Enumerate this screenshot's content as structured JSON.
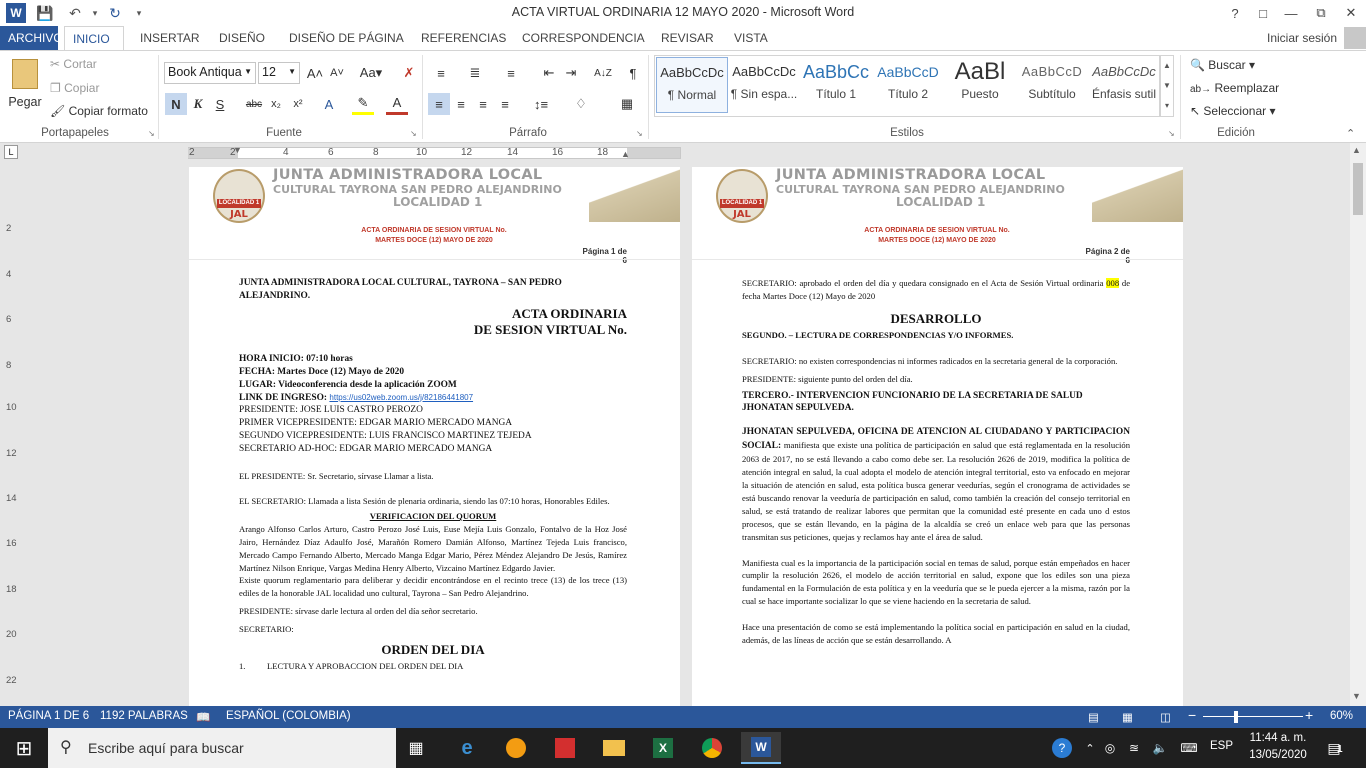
{
  "window": {
    "title": "ACTA VIRTUAL ORDINARIA 12 MAYO 2020 - Microsoft Word",
    "help": "?",
    "signin": "Iniciar sesión"
  },
  "tabs": [
    "ARCHIVO",
    "INICIO",
    "INSERTAR",
    "DISEÑO",
    "DISEÑO DE PÁGINA",
    "REFERENCIAS",
    "CORRESPONDENCIA",
    "REVISAR",
    "VISTA"
  ],
  "ribbon": {
    "clipboard": {
      "paste": "Pegar",
      "cut": "Cortar",
      "copy": "Copiar",
      "format_painter": "Copiar formato",
      "label": "Portapapeles"
    },
    "font": {
      "family": "Book Antiqua",
      "size": "12",
      "label": "Fuente"
    },
    "paragraph": {
      "label": "Párrafo"
    },
    "styles": {
      "label": "Estilos",
      "items": [
        {
          "preview": "AaBbCcDc",
          "name": "¶ Normal"
        },
        {
          "preview": "AaBbCcDc",
          "name": "¶ Sin espa..."
        },
        {
          "preview": "AaBbCc",
          "name": "Título 1"
        },
        {
          "preview": "AaBbCcD",
          "name": "Título 2"
        },
        {
          "preview": "AaBl",
          "name": "Puesto"
        },
        {
          "preview": "AaBbCcD",
          "name": "Subtítulo"
        },
        {
          "preview": "AaBbCcDc",
          "name": "Énfasis sutil"
        }
      ]
    },
    "editing": {
      "find": "Buscar",
      "replace": "Reemplazar",
      "select": "Seleccionar",
      "label": "Edición"
    }
  },
  "ruler": [
    "2",
    "2",
    "4",
    "6",
    "8",
    "10",
    "12",
    "14",
    "16",
    "18"
  ],
  "vruler": [
    "2",
    "4",
    "6",
    "8",
    "10",
    "12",
    "14",
    "16",
    "18",
    "20",
    "22"
  ],
  "header": {
    "line1": "JUNTA ADMINISTRADORA LOCAL",
    "line2": "CULTURAL TAYRONA SAN PEDRO ALEJANDRINO",
    "line3": "LOCALIDAD 1",
    "logo_text": "LOCALIDAD 1",
    "logo_jal": "JAL",
    "acta1": "ACTA ORDINARIA DE SESION VIRTUAL No.",
    "acta2": "MARTES DOCE (12) MAYO DE 2020"
  },
  "page1": {
    "pgnum": "Página 1 de 6",
    "org": "JUNTA ADMINISTRADORA LOCAL CULTURAL, TAYRONA – SAN PEDRO ALEJANDRINO.",
    "title1": "ACTA ORDINARIA",
    "title2": "DE SESION VIRTUAL No.",
    "hora": "HORA INICIO: 07:10 horas",
    "fecha": "FECHA: Martes Doce (12) Mayo de 2020",
    "lugar": "LUGAR: Videoconferencia desde la aplicación ZOOM",
    "link_label": "LINK DE INGRESO:",
    "link": "https://us02web.zoom.us/j/82186441807",
    "presidente": "PRESIDENTE: JOSE LUIS CASTRO PEROZO",
    "primer": "PRIMER VICEPRESIDENTE: EDGAR MARIO MERCADO MANGA",
    "segundo": "SEGUNDO VICEPRESIDENTE: LUIS FRANCISCO MARTINEZ TEJEDA",
    "secretario": "SECRETARIO AD-HOC: EDGAR MARIO MERCADO MANGA",
    "p_pres": "EL PRESIDENTE: Sr. Secretario, sírvase Llamar a lista.",
    "p_sec": "EL SECRETARIO: Llamada a lista Sesión de plenaria ordinaria, siendo las 07:10 horas, Honorables Ediles.",
    "quorum_title": "VERIFICACION DEL QUORUM",
    "quorum_text": "Arango Alfonso Carlos Arturo, Castro Perozo José Luis, Euse Mejía Luis Gonzalo, Fontalvo de la Hoz José Jairo, Hernández Díaz Adaulfo José, Marañón Romero Damián Alfonso, Martínez Tejeda Luis francisco, Mercado Campo Fernando Alberto, Mercado Manga Edgar Mario,  Pérez Méndez Alejandro De Jesús, Ramírez Martínez Nilson Enrique, Vargas Medina Henry Alberto, Vizcaino Martínez Edgardo Javier.",
    "quorum_text2": "Existe quorum reglamentario para deliberar y decidir encontrándose en el recinto trece (13) de los trece (13) ediles de la  honorable JAL localidad uno cultural, Tayrona – San Pedro Alejandrino.",
    "p_pres2": "PRESIDENTE: sírvase darle lectura al orden del día señor secretario.",
    "p_sec2": "SECRETARIO:",
    "orden": "ORDEN DEL DIA",
    "item1_num": "1.",
    "item1": "LECTURA Y APROBACCION DEL ORDEN DEL DIA"
  },
  "page2": {
    "pgnum": "Página 2 de 6",
    "sec1a": "SECRETARIO: aprobado el orden del día y quedara consignado en el Acta de Sesión Virtual ordinaria",
    "sec1_hl": "008",
    "sec1b": "de fecha Martes Doce (12) Mayo de 2020",
    "desarrollo": "DESARROLLO",
    "segundo": "SEGUNDO. – LECTURA DE CORRESPONDENCIAS Y/O INFORMES.",
    "sec2": "SECRETARIO: no existen correspondencias ni informes radicados en la secretaria general de la corporación.",
    "pres": "PRESIDENTE: siguiente punto del orden del día.",
    "tercero": "TERCERO.-  INTERVENCION FUNCIONARIO DE LA SECRETARIA DE SALUD JHONATAN SEPULVEDA.",
    "jhon_bold": "JHONATAN SEPULVEDA, OFICINA DE ATENCION AL CIUDADANO Y PARTICIPACION SOCIAL:",
    "jhon_text": " manifiesta que existe una política de participación en salud que está reglamentada en la resolución 2063 de 2017, no se está llevando a cabo como debe ser. La resolución 2626 de 2019, modifica la política de atención integral en salud, la cual adopta el modelo de atención integral territorial, esto va enfocado en mejorar la situación de atención en salud, esta política busca generar veedurías, según el cronograma de actividades se está buscando renovar la veeduría de participación en salud, como también la creación del consejo territorial en salud, se está tratando de realizar labores que permitan que la comunidad esté presente en cada uno d estos procesos, que se están llevando, en la página de la alcaldía se creó un enlace web para que las personas transmitan sus peticiones, quejas y reclamos hay ante el área de salud.",
    "para2": "Manifiesta cual es la importancia de la participación social en temas de salud, porque están empeñados en hacer cumplir la resolución 2626, el modelo de acción territorial en salud, expone que los ediles son una pieza fundamental en la Formulación de esta política y en la veeduría que se le pueda ejercer a la misma, razón por la cual se hace importante socializar lo que se viene haciendo en la secretaria de salud.",
    "para3": "Hace una presentación de como se está implementando la política social en participación en salud en la ciudad, además, de las líneas de acción que se están desarrollando. A"
  },
  "status": {
    "page": "PÁGINA 1 DE 6",
    "words": "1192 PALABRAS",
    "lang": "ESPAÑOL (COLOMBIA)",
    "zoom": "60%",
    "zoom_level": 0.33
  },
  "taskbar": {
    "search": "Escribe aquí para buscar",
    "time": "11:44 a. m.",
    "date": "13/05/2020",
    "lang": "ESP",
    "notif": "1"
  },
  "colors": {
    "accent": "#2b579a",
    "header_red": "#c0392b",
    "highlight": "#ffff00"
  }
}
